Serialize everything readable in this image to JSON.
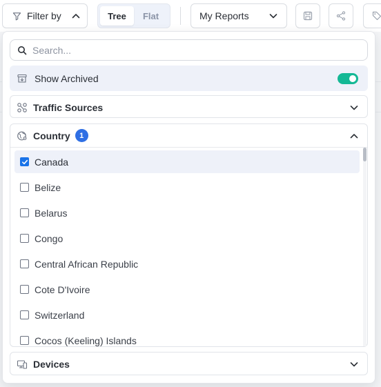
{
  "toolbar": {
    "filter_label": "Filter by",
    "view_toggle": {
      "tree": "Tree",
      "flat": "Flat",
      "active": "Tree"
    },
    "reports_label": "My Reports"
  },
  "filter_panel": {
    "search": {
      "placeholder": "Search...",
      "value": ""
    },
    "show_archived": {
      "label": "Show Archived",
      "enabled": true
    },
    "sections": {
      "traffic_sources": {
        "title": "Traffic Sources",
        "expanded": false
      },
      "country": {
        "title": "Country",
        "selected_count": "1",
        "expanded": true,
        "items": [
          {
            "label": "Canada",
            "checked": true
          },
          {
            "label": "Belize",
            "checked": false
          },
          {
            "label": "Belarus",
            "checked": false
          },
          {
            "label": "Congo",
            "checked": false
          },
          {
            "label": "Central African Republic",
            "checked": false
          },
          {
            "label": "Cote D'Ivoire",
            "checked": false
          },
          {
            "label": "Switzerland",
            "checked": false
          },
          {
            "label": "Cocos (Keeling) Islands",
            "checked": false
          }
        ]
      },
      "devices": {
        "title": "Devices",
        "expanded": false
      }
    }
  },
  "colors": {
    "accent": "#1a73e8",
    "toggle_on": "#14b895",
    "badge": "#2f6fe4",
    "selected_row": "#eef1f9"
  }
}
